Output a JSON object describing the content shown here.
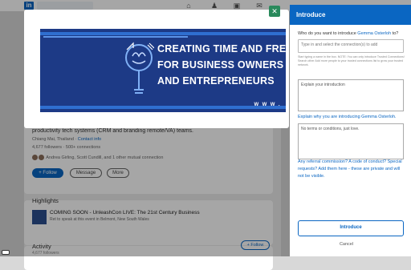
{
  "topbar": {
    "logo": "in",
    "icons": [
      "home-icon",
      "network-icon",
      "jobs-icon",
      "messaging-icon",
      "notifications-icon"
    ]
  },
  "profile": {
    "tagline": "productivity tech systems (CRM and branding remote/VA) teams.",
    "location": "Chiang Mai, Thailand · ",
    "contact_link": "Contact info",
    "connections": "4,677 followers · 500+ connections",
    "mutual": "Andrea Girling, Scott Cundill, and 1 other mutual connection",
    "follow_label": "+ Follow",
    "message_label": "Message",
    "more_label": "More"
  },
  "highlights": {
    "title": "Highlights",
    "item_title": "COMING SOON - UnleashCon LIVE: The 21st Century Business",
    "item_sub": "Ret to speak at this event in Belmont, New South Wales"
  },
  "activity": {
    "title": "Activity",
    "sub": "4,677 followers",
    "follow_label": "+ Follow"
  },
  "banner": {
    "line1": "CREATING TIME AND FRE",
    "line2": "FOR BUSINESS OWNERS",
    "line3": "AND ENTREPRENEURS",
    "url": "W W W ."
  },
  "panel": {
    "title": "Introduce",
    "question_prefix": "Who do you want to introduce ",
    "question_name": "Gemma Osterloh",
    "question_suffix": " to?",
    "input_placeholder": "Type in and select the connection(s) to add",
    "hint": "Start typing a name in the box. NOTE: You can only introduce Trusted Connections! Search other Add more people to your trusted connections list to grow your trusted network.",
    "explain_placeholder": "Explain your introduction",
    "explain_link": "Explain why you are introducing Gemma Osterloh.",
    "terms_placeholder": "No terms or conditions, just love.",
    "referral_text": "Any referral commission? A code of conduct? Special requests? Add them here - these are private and will not be visible.",
    "introduce_button": "Introduce",
    "cancel_label": "Cancel"
  },
  "colors": {
    "accent": "#0a66c2",
    "banner_bg": "#1d3a86",
    "close_button": "#2a8a5c"
  }
}
